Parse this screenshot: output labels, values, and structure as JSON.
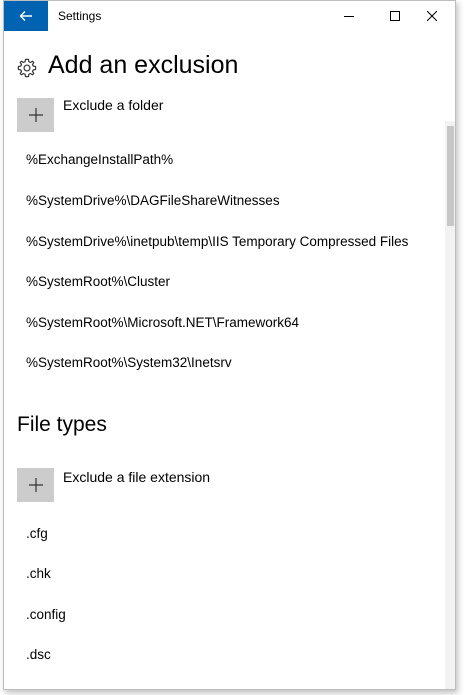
{
  "window": {
    "title": "Settings"
  },
  "header": {
    "title": "Add an exclusion"
  },
  "folders": {
    "add_label": "Exclude a folder",
    "items": [
      "%ExchangeInstallPath%",
      "%SystemDrive%\\DAGFileShareWitnesses",
      "%SystemDrive%\\inetpub\\temp\\IIS Temporary Compressed Files",
      "%SystemRoot%\\Cluster",
      "%SystemRoot%\\Microsoft.NET\\Framework64",
      "%SystemRoot%\\System32\\Inetsrv"
    ]
  },
  "file_types": {
    "title": "File types",
    "add_label": "Exclude a file extension",
    "items": [
      ".cfg",
      ".chk",
      ".config",
      ".dsc"
    ]
  },
  "icons": {
    "back": "back-arrow-icon",
    "minimize": "minimize-icon",
    "maximize": "maximize-icon",
    "close": "close-icon",
    "settings": "gear-icon",
    "add": "plus-icon"
  },
  "colors": {
    "accent": "#0063b1",
    "add_button_bg": "#cccccc",
    "scrollbar_thumb": "#c7c7c7"
  }
}
